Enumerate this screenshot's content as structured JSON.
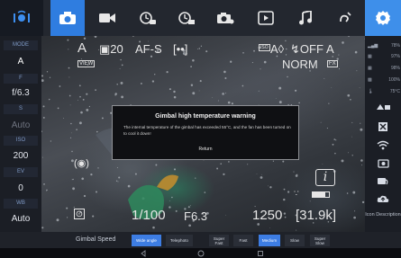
{
  "colors": {
    "accent": "#2f7de0",
    "settings": "#3e8fea",
    "panel": "#1b1e25",
    "label": "#7f9ac6"
  },
  "topbar": {
    "tabs": [
      {
        "icon": "gimbal-mode-icon",
        "state": "logo"
      },
      {
        "icon": "camera-icon",
        "state": "active"
      },
      {
        "icon": "video-camera-icon",
        "state": "normal"
      },
      {
        "icon": "timelapse-camera-icon",
        "state": "normal"
      },
      {
        "icon": "timelapse-video-icon",
        "state": "normal"
      },
      {
        "icon": "camera-add-icon",
        "state": "normal"
      },
      {
        "icon": "playback-icon",
        "state": "normal"
      },
      {
        "icon": "music-note-icon",
        "state": "normal"
      },
      {
        "icon": "motion-path-icon",
        "state": "normal"
      },
      {
        "icon": "settings-icon",
        "state": "settings"
      }
    ]
  },
  "left_panel": {
    "mode_label": "MODE",
    "mode_value": "A",
    "f_label": "F",
    "f_value": "f/6.3",
    "s_label": "S",
    "s_value": "Auto",
    "iso_label": "ISO",
    "iso_value": "200",
    "ev_label": "EV",
    "ev_value": "0",
    "wb_label": "WB",
    "wb_value": "Auto"
  },
  "right_panel": {
    "status": [
      {
        "icon": "signal-icon",
        "value": "78%"
      },
      {
        "icon": "battery-icon",
        "value": "97%"
      },
      {
        "icon": "battery-icon",
        "value": "98%"
      },
      {
        "icon": "camera-battery-icon",
        "value": "100%"
      },
      {
        "icon": "temperature-icon",
        "value": "75°C"
      }
    ],
    "buttons": [
      {
        "icon": "transfer-icon"
      },
      {
        "icon": "focus-target-icon"
      },
      {
        "icon": "wifi-icon"
      },
      {
        "icon": "camera-icon"
      },
      {
        "icon": "camera-rotate-icon"
      },
      {
        "icon": "cloud-upload-icon"
      }
    ],
    "icon_description": "Icon Description"
  },
  "viewfinder": {
    "mode": "A",
    "image_quality_icon": "burst-icon",
    "shots_remaining": "20",
    "focus_mode": "AF-S",
    "af_area": "[••]",
    "view_badge": "VIEW",
    "iso_badge": "ISO",
    "iso_display": "A◊",
    "flash": "↯OFF",
    "wb_display": "A",
    "picture_style": "NORM",
    "fx_badge": "FX",
    "shutter_display": "1/100",
    "aperture_display": "F6.3",
    "iso_value_display": "1250",
    "remaining_display": "[31.9k]"
  },
  "modal": {
    "title": "Gimbal high temperature warning",
    "body": "The internal temperature of the gimbal has exceeded 55°C, and the fan has been turned on to cool it down!",
    "button": "Return"
  },
  "bottom_bar": {
    "label": "Gimbal Speed",
    "buttons": [
      {
        "label": "Wide angle",
        "selected": true
      },
      {
        "label": "Telephoto",
        "selected": false
      },
      {
        "label": "Super Fast",
        "selected": false
      },
      {
        "label": "Fast",
        "selected": false
      },
      {
        "label": "Medium",
        "selected": true
      },
      {
        "label": "Slow",
        "selected": false
      },
      {
        "label": "Super Slow",
        "selected": false
      }
    ]
  },
  "navbar": {
    "items": [
      {
        "icon": "back-icon"
      },
      {
        "icon": "home-icon"
      },
      {
        "icon": "recents-icon"
      }
    ]
  }
}
